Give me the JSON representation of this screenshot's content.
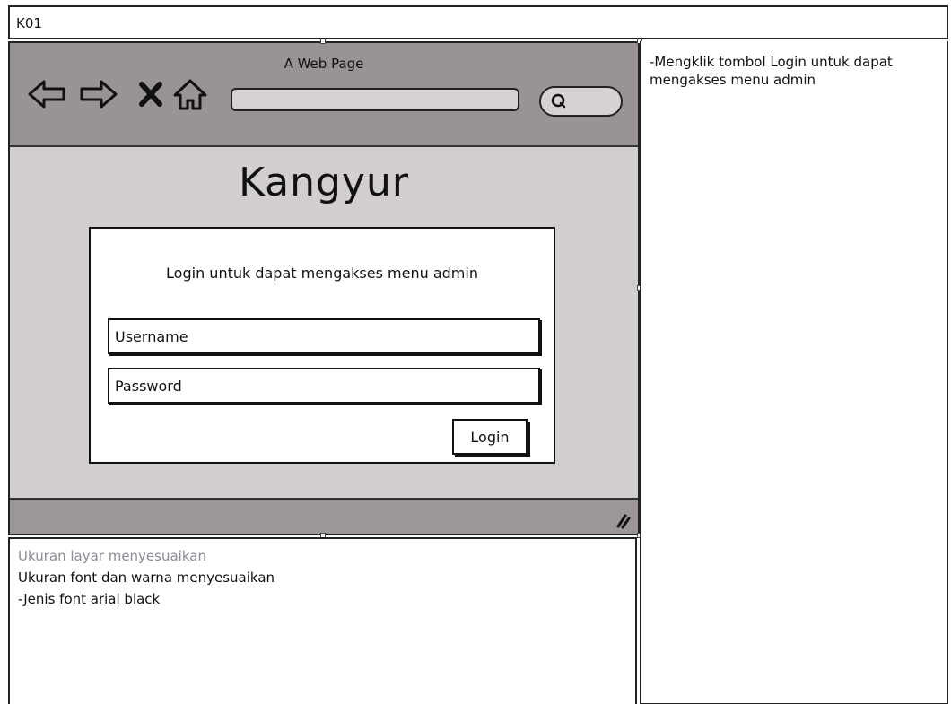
{
  "frame": {
    "id_label": "K01"
  },
  "browser": {
    "title": "A Web Page",
    "icons": [
      "back-arrow-icon",
      "forward-arrow-icon",
      "stop-icon",
      "home-icon",
      "search-icon",
      "resize-grip-icon"
    ],
    "url_value": ""
  },
  "page": {
    "brand": "Kangyur",
    "login": {
      "message": "Login untuk dapat mengakses menu admin",
      "username_placeholder": "Username",
      "password_placeholder": "Password",
      "button_label": "Login"
    }
  },
  "notes": {
    "right": "-Mengklik tombol Login untuk dapat mengakses menu admin",
    "bottom_line1": "Ukuran layar menyesuaikan",
    "bottom_line2": "Ukuran font dan warna menyesuaikan",
    "bottom_line3": "-Jenis font arial black"
  },
  "colors": {
    "browser_chrome": "#999393",
    "page_background": "#d3cece",
    "muted_text": "#8b8b95"
  }
}
